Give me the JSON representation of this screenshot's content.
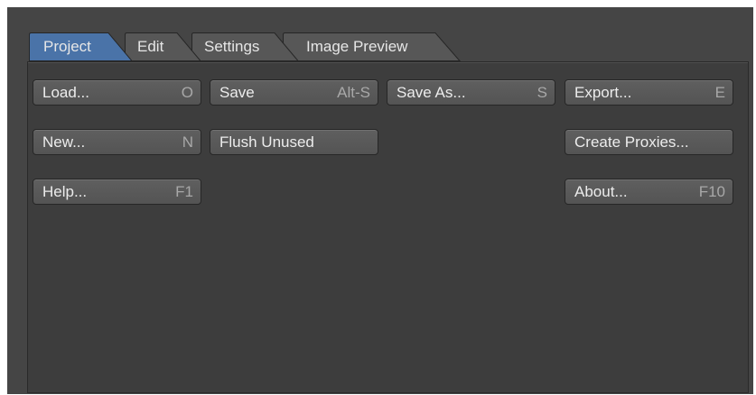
{
  "tabs": [
    {
      "label": "Project",
      "active": true
    },
    {
      "label": "Edit",
      "active": false
    },
    {
      "label": "Settings",
      "active": false
    },
    {
      "label": "Image Preview",
      "active": false
    }
  ],
  "buttons": {
    "load": {
      "label": "Load...",
      "shortcut": "O"
    },
    "save": {
      "label": "Save",
      "shortcut": "Alt-S"
    },
    "save_as": {
      "label": "Save As...",
      "shortcut": "S"
    },
    "export": {
      "label": "Export...",
      "shortcut": "E"
    },
    "new": {
      "label": "New...",
      "shortcut": "N"
    },
    "flush_unused": {
      "label": "Flush Unused"
    },
    "create_proxies": {
      "label": "Create Proxies..."
    },
    "help": {
      "label": "Help...",
      "shortcut": "F1"
    },
    "about": {
      "label": "About...",
      "shortcut": "F10"
    }
  },
  "colors": {
    "active_tab": "#4a73a8",
    "inactive_tab": "#5a5a5a",
    "panel_bg": "#3d3d3d",
    "button_bg": "#5a5a5a"
  }
}
